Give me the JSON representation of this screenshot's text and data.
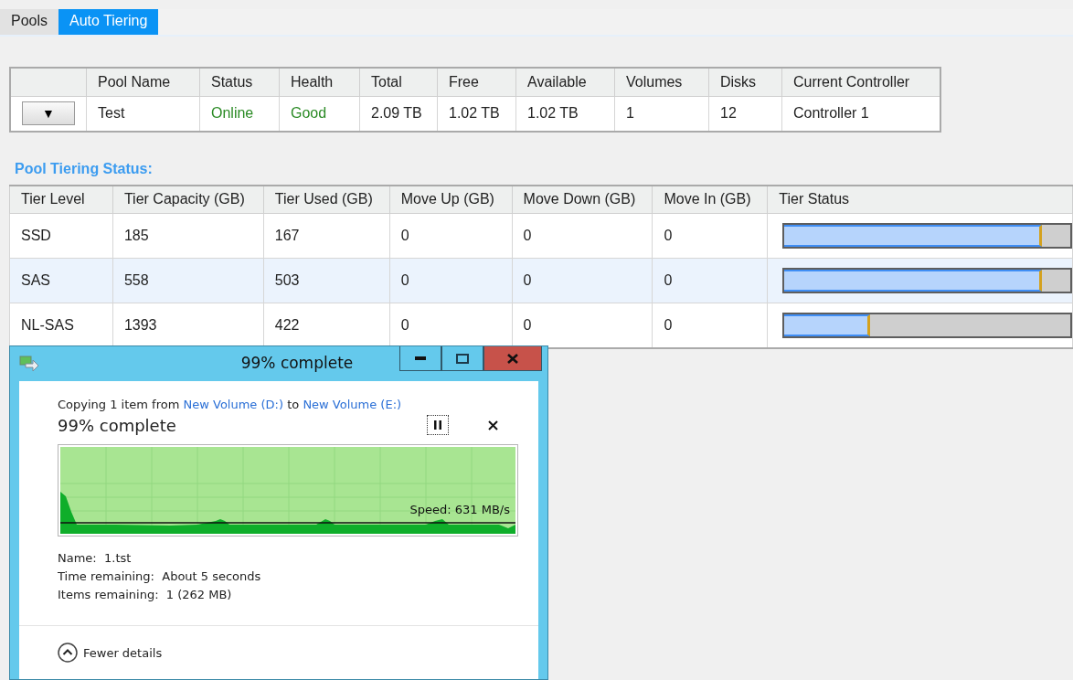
{
  "tabs": [
    {
      "label": "Pools",
      "selected": false
    },
    {
      "label": "Auto Tiering",
      "selected": true
    }
  ],
  "pool_table": {
    "columns": [
      "Pool Name",
      "Status",
      "Health",
      "Total",
      "Free",
      "Available",
      "Volumes",
      "Disks",
      "Current Controller"
    ],
    "rows": [
      {
        "cells": [
          {
            "text": "Test",
            "good": false
          },
          {
            "text": "Online",
            "good": true
          },
          {
            "text": "Good",
            "good": true
          },
          {
            "text": "2.09 TB",
            "good": false
          },
          {
            "text": "1.02 TB",
            "good": false
          },
          {
            "text": "1.02 TB",
            "good": false
          },
          {
            "text": "1",
            "good": false
          },
          {
            "text": "12",
            "good": false
          },
          {
            "text": "Controller 1",
            "good": false
          }
        ],
        "expand": "▼"
      }
    ]
  },
  "tiering": {
    "heading": "Pool Tiering Status:",
    "columns": [
      "Tier Level",
      "Tier Capacity (GB)",
      "Tier Used (GB)",
      "Move Up (GB)",
      "Move Down (GB)",
      "Move In (GB)",
      "Tier Status"
    ],
    "rows": [
      {
        "cells": [
          "SSD",
          "185",
          "167",
          "0",
          "0",
          "0"
        ],
        "level": 0.9
      },
      {
        "cells": [
          "SAS",
          "558",
          "503",
          "0",
          "0",
          "0"
        ],
        "level": 0.9
      },
      {
        "cells": [
          "NL-SAS",
          "1393",
          "422",
          "0",
          "0",
          "0"
        ],
        "level": 0.3
      }
    ]
  },
  "copy_dialog": {
    "title": "99% complete",
    "message": {
      "prefix": "Copying 1 item from",
      "source": "New Volume (D:)",
      "middle": "to",
      "destination": "New Volume (E:)"
    },
    "progress": "99% complete",
    "speed": "Speed: 631 MB/s",
    "details": [
      "Name:  1.tst",
      "Time remaining:  About 5 seconds",
      "Items remaining:  1 (262 MB)"
    ],
    "toggle": "Fewer details"
  }
}
